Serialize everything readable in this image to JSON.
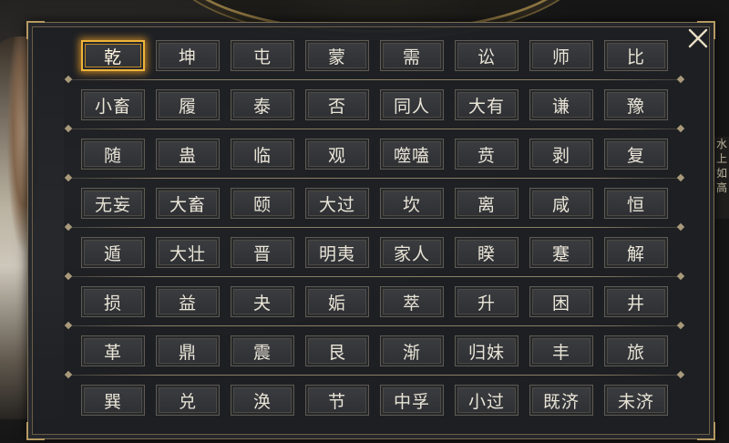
{
  "background": {
    "right_panel_text": "水上如高"
  },
  "dialog": {
    "close_icon": "close-x-icon",
    "selected_index": 0,
    "accent_color": "#f0b43a",
    "rows": [
      [
        "乾",
        "坤",
        "屯",
        "蒙",
        "需",
        "讼",
        "师",
        "比"
      ],
      [
        "小畜",
        "履",
        "泰",
        "否",
        "同人",
        "大有",
        "谦",
        "豫"
      ],
      [
        "随",
        "蛊",
        "临",
        "观",
        "噬嗑",
        "贲",
        "剥",
        "复"
      ],
      [
        "无妄",
        "大畜",
        "颐",
        "大过",
        "坎",
        "离",
        "咸",
        "恒"
      ],
      [
        "遁",
        "大壮",
        "晋",
        "明夷",
        "家人",
        "睽",
        "蹇",
        "解"
      ],
      [
        "损",
        "益",
        "夬",
        "姤",
        "萃",
        "升",
        "困",
        "井"
      ],
      [
        "革",
        "鼎",
        "震",
        "艮",
        "渐",
        "归妹",
        "丰",
        "旅"
      ],
      [
        "巽",
        "兑",
        "涣",
        "节",
        "中孚",
        "小过",
        "既济",
        "未济"
      ]
    ]
  }
}
